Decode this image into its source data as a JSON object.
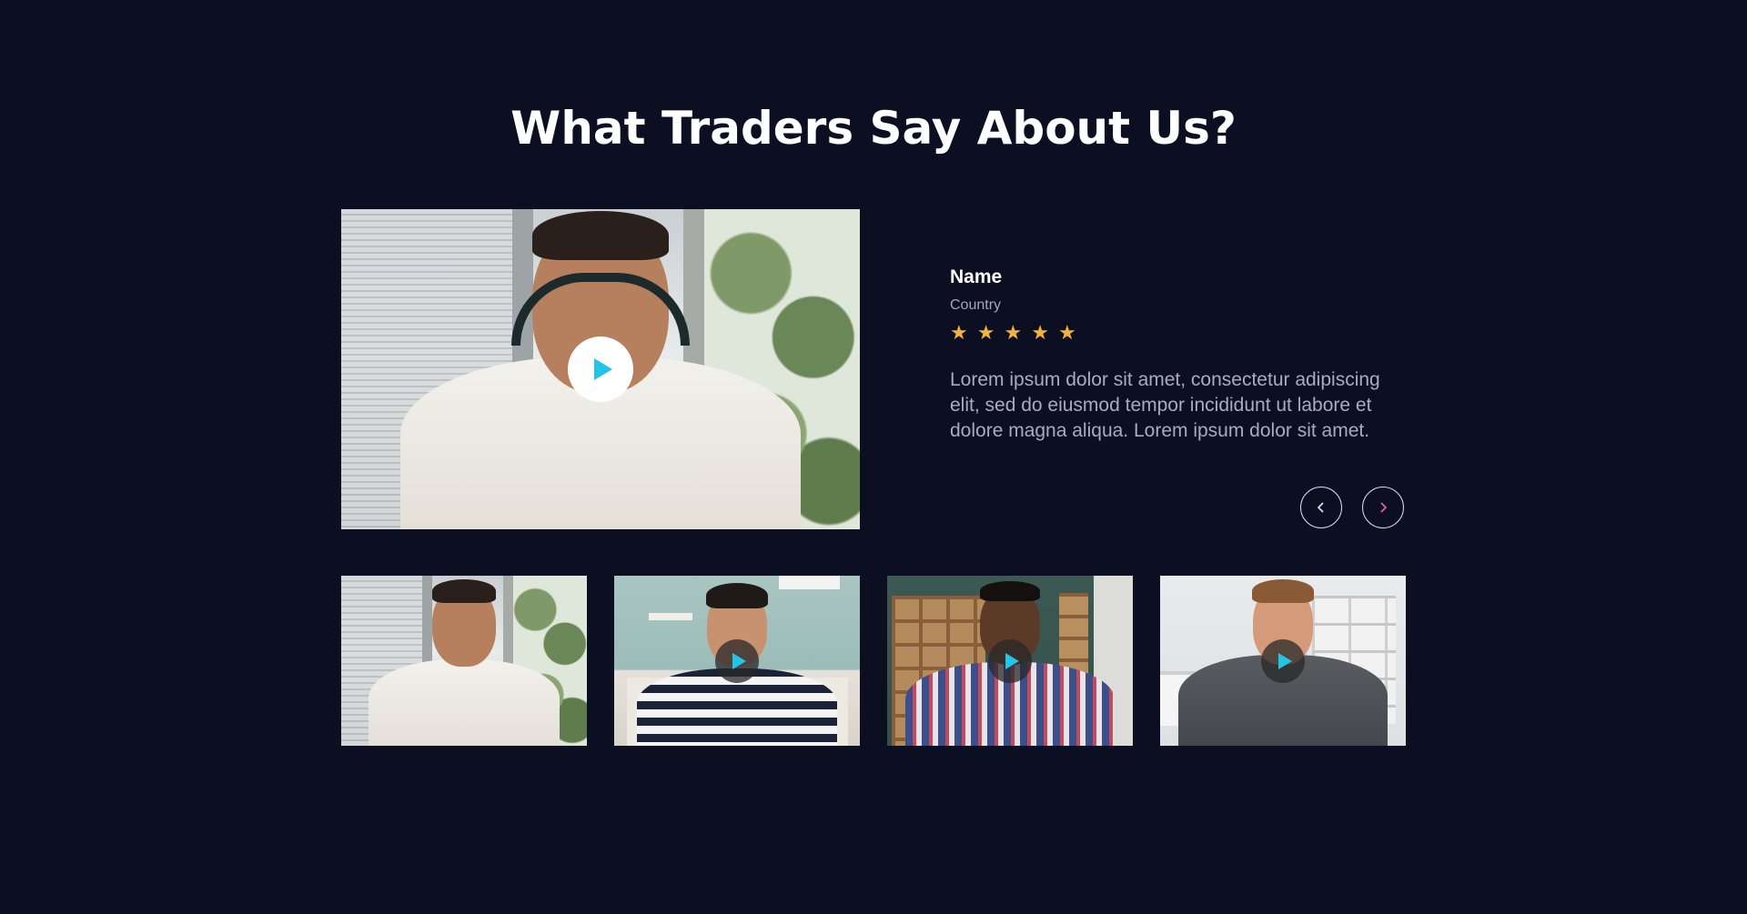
{
  "section": {
    "title": "What Traders Say About Us?"
  },
  "featured": {
    "play_icon": "play-icon",
    "accent_color": "#22c5e8"
  },
  "testimonial": {
    "name": "Name",
    "country": "Country",
    "rating": 5,
    "star_glyph": "★",
    "star_color": "#f3b23a",
    "quote": "Lorem ipsum dolor sit amet, consectetur adipiscing elit, sed do eiusmod tempor incididunt ut labore et dolore magna aliqua. Lorem ipsum dolor sit amet."
  },
  "navigation": {
    "prev_icon": "chevron-left-icon",
    "next_icon": "chevron-right-icon"
  },
  "thumbnails": [
    {
      "scene": "window-headphones",
      "has_play": false
    },
    {
      "scene": "kitchen-striped-shirt",
      "has_play": true
    },
    {
      "scene": "bookshelves-plaid-shirt",
      "has_play": true
    },
    {
      "scene": "office-blazer",
      "has_play": true
    }
  ],
  "colors": {
    "background": "#0c0e22",
    "title": "#ffffff",
    "muted_text": "#a7acc4",
    "star": "#f3b23a",
    "play_accent": "#22c5e8"
  }
}
